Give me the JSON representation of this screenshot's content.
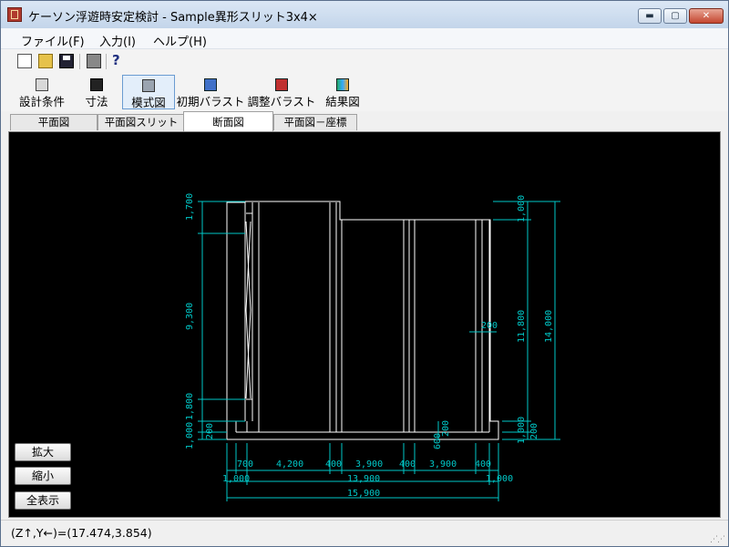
{
  "window": {
    "title": "ケーソン浮遊時安定検討 - Sample異形スリット3x4×",
    "min_label": "▬",
    "max_label": "▢",
    "close_label": "✕"
  },
  "menu": {
    "file": "ファイル(F)",
    "input": "入力(I)",
    "help": "ヘルプ(H)"
  },
  "toolbar": {
    "icons": [
      "new-file-icon",
      "open-folder-icon",
      "save-disk-icon",
      "print-icon",
      "help-icon"
    ],
    "help_glyph": "?"
  },
  "big_buttons": [
    {
      "label": "設計条件",
      "icon": "design-conditions-icon"
    },
    {
      "label": "寸法",
      "icon": "dimensions-icon"
    },
    {
      "label": "模式図",
      "icon": "schematic-icon",
      "active": true
    },
    {
      "label": "初期バラスト",
      "icon": "initial-ballast-icon"
    },
    {
      "label": "調整バラスト",
      "icon": "adjust-ballast-icon"
    },
    {
      "label": "結果図",
      "icon": "result-chart-icon"
    }
  ],
  "tabs": [
    {
      "label": "平面図"
    },
    {
      "label": "平面図スリット"
    },
    {
      "label": "断面図",
      "active": true
    },
    {
      "label": "平面図－座標"
    }
  ],
  "drawing": {
    "left_dims": [
      "1,700",
      "9,300",
      "1,800",
      "1,000",
      "200"
    ],
    "right_dims": [
      "1,000",
      "11,800",
      "14,000",
      "1,000",
      "200"
    ],
    "inner_dims": [
      "200",
      "200",
      "600"
    ],
    "bottom_row1": [
      "700",
      "4,200",
      "400",
      "3,900",
      "400",
      "3,900",
      "400"
    ],
    "bottom_row2": [
      "1,000",
      "13,900",
      "1,000"
    ],
    "bottom_total": "15,900"
  },
  "side_buttons": {
    "zoom_in": "拡大",
    "zoom_out": "縮小",
    "show_all": "全表示"
  },
  "status": {
    "coords": "(Z↑,Y←)=(17.474,3.854)"
  },
  "colors": {
    "drawing_line": "#ffffff",
    "dimension": "#00c8c8",
    "canvas_bg": "#000000"
  }
}
